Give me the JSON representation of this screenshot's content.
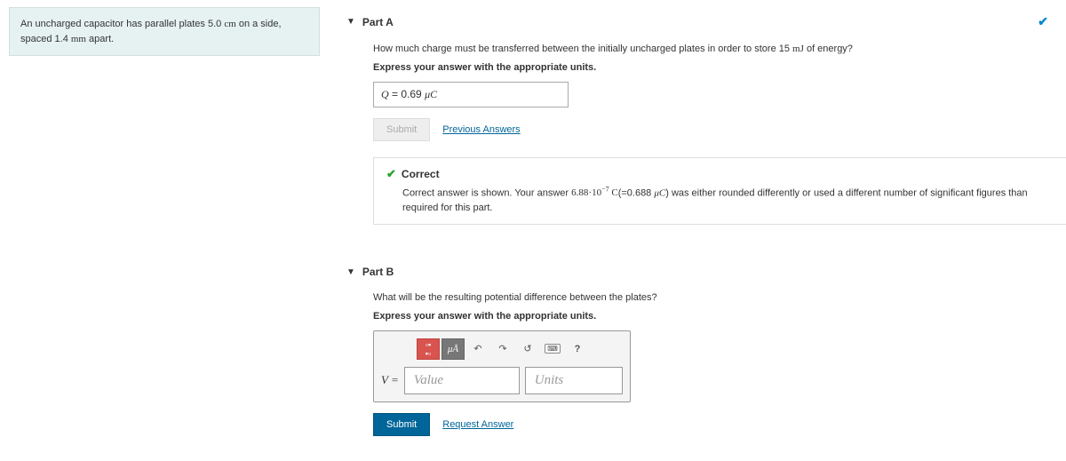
{
  "problem": {
    "statement_html": "An uncharged capacitor has parallel plates 5.0 cm on a side, spaced 1.4 mm apart."
  },
  "partA": {
    "title": "Part A",
    "question": "How much charge must be transferred between the initially uncharged plates in order to store 15 mJ of energy?",
    "instruction": "Express your answer with the appropriate units.",
    "answer_label": "Q =",
    "answer_value": "0.69",
    "answer_unit": "μC",
    "submit_label": "Submit",
    "prev_answers_label": "Previous Answers",
    "feedback": {
      "title": "Correct",
      "text": "Correct answer is shown. Your answer 6.88·10⁻⁷ C(=0.688 μC) was either rounded differently or used a different number of significant figures than required for this part."
    }
  },
  "partB": {
    "title": "Part B",
    "question": "What will be the resulting potential difference between the plates?",
    "instruction": "Express your answer with the appropriate units.",
    "var_label": "V =",
    "value_placeholder": "Value",
    "units_placeholder": "Units",
    "toolbar": {
      "templates": "□",
      "units": "μÅ",
      "undo": "↶",
      "redo": "↷",
      "reset": "↺",
      "keyboard": "⌨",
      "help": "?"
    },
    "submit_label": "Submit",
    "request_answer_label": "Request Answer"
  }
}
